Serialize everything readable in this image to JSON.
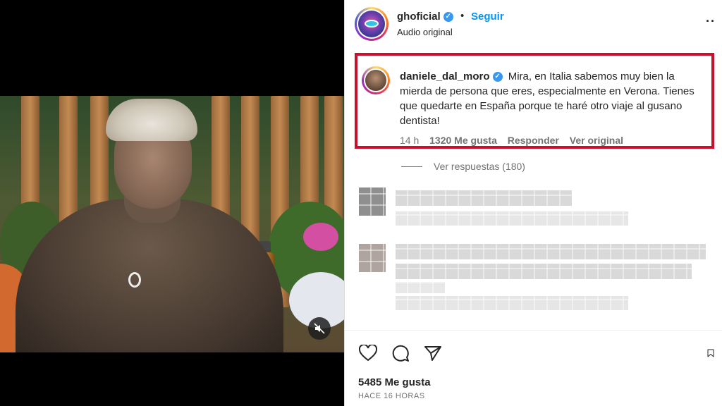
{
  "header": {
    "username": "ghoficial",
    "follow_label": "Seguir",
    "audio_label": "Audio original",
    "more_icon": "more-options-icon"
  },
  "comment": {
    "username": "daniele_dal_moro",
    "text": "Mira, en Italia sabemos muy bien la mierda de persona que eres, especialmente en Verona. Tienes que quedarte en España porque te haré otro viaje al gusano dentista!",
    "age": "14 h",
    "likes": "1320 Me gusta",
    "reply_label": "Responder",
    "original_label": "Ver original",
    "highlight_color": "#c8102e"
  },
  "replies": {
    "label": "Ver respuestas (180)"
  },
  "footer": {
    "likes": "5485 Me gusta",
    "time": "HACE 16 HORAS"
  },
  "colors": {
    "link": "#0095f6",
    "verified": "#3897f0",
    "text": "#262626",
    "muted": "#737373"
  }
}
